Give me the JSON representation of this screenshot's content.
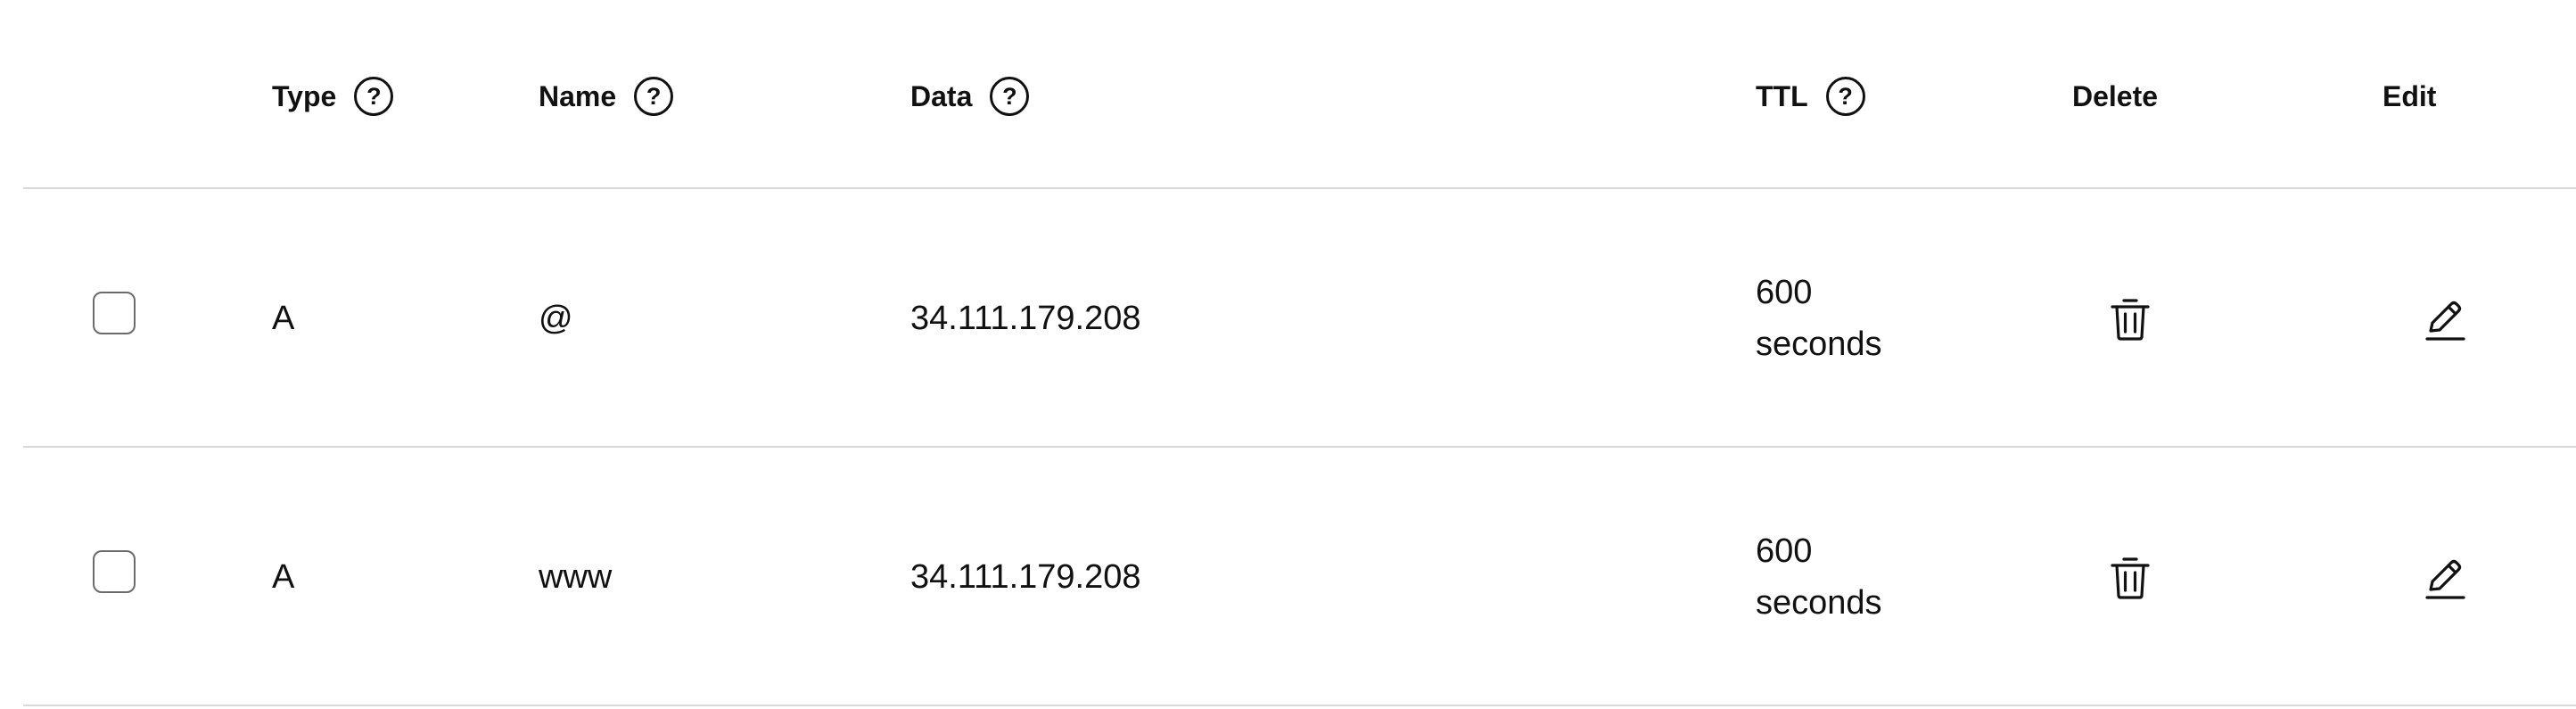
{
  "columns": {
    "type": "Type",
    "name": "Name",
    "data": "Data",
    "ttl": "TTL",
    "delete": "Delete",
    "edit": "Edit",
    "help_glyph": "?"
  },
  "records": [
    {
      "type": "A",
      "name": "@",
      "data": "34.111.179.208",
      "ttl_value": "600",
      "ttl_unit": "seconds"
    },
    {
      "type": "A",
      "name": "www",
      "data": "34.111.179.208",
      "ttl_value": "600",
      "ttl_unit": "seconds"
    }
  ],
  "icons": {
    "help": "question-circle-icon",
    "delete": "trash-icon",
    "edit": "pencil-icon"
  },
  "colors": {
    "divider": "#d9d9d9",
    "text": "#111111",
    "checkbox_border": "#6b6b6b"
  }
}
